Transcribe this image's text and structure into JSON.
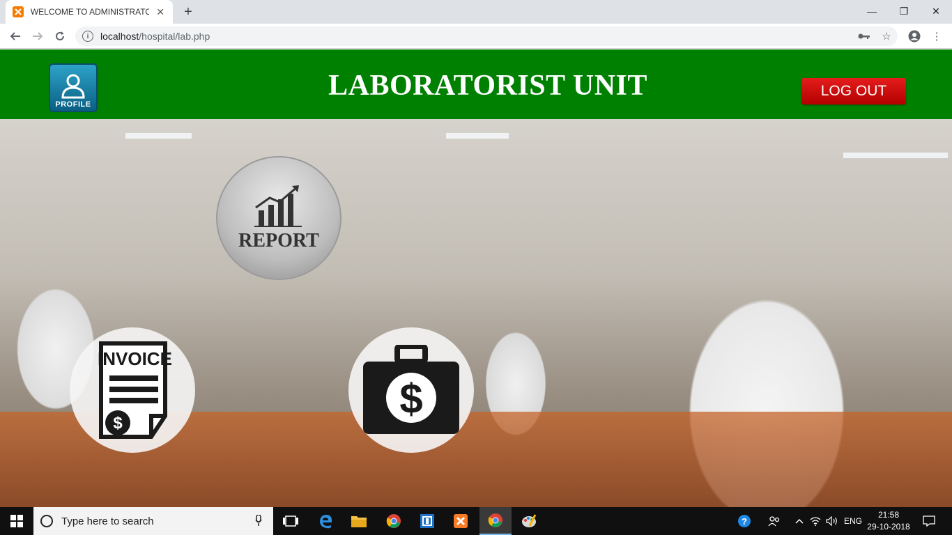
{
  "browser": {
    "tab_title": "WELCOME TO ADMINISTRATOR",
    "tab_close": "✕",
    "new_tab": "+",
    "url_host": "localhost",
    "url_path": "/hospital/lab.php",
    "window_controls": {
      "minimize": "—",
      "restore": "❐",
      "close": "✕"
    }
  },
  "header": {
    "profile_label": "PROFILE",
    "title": "LABORATORIST UNIT",
    "logout_label": "LOG OUT"
  },
  "tiles": {
    "report_label": "REPORT",
    "invoice_label": "INVOICE",
    "money_symbol": "$"
  },
  "taskbar": {
    "search_placeholder": "Type here to search",
    "language": "ENG",
    "time": "21:58",
    "date": "29-10-2018"
  },
  "colors": {
    "header_green": "#008000",
    "logout_red": "#d00000",
    "taskbar_bg": "#101010"
  }
}
